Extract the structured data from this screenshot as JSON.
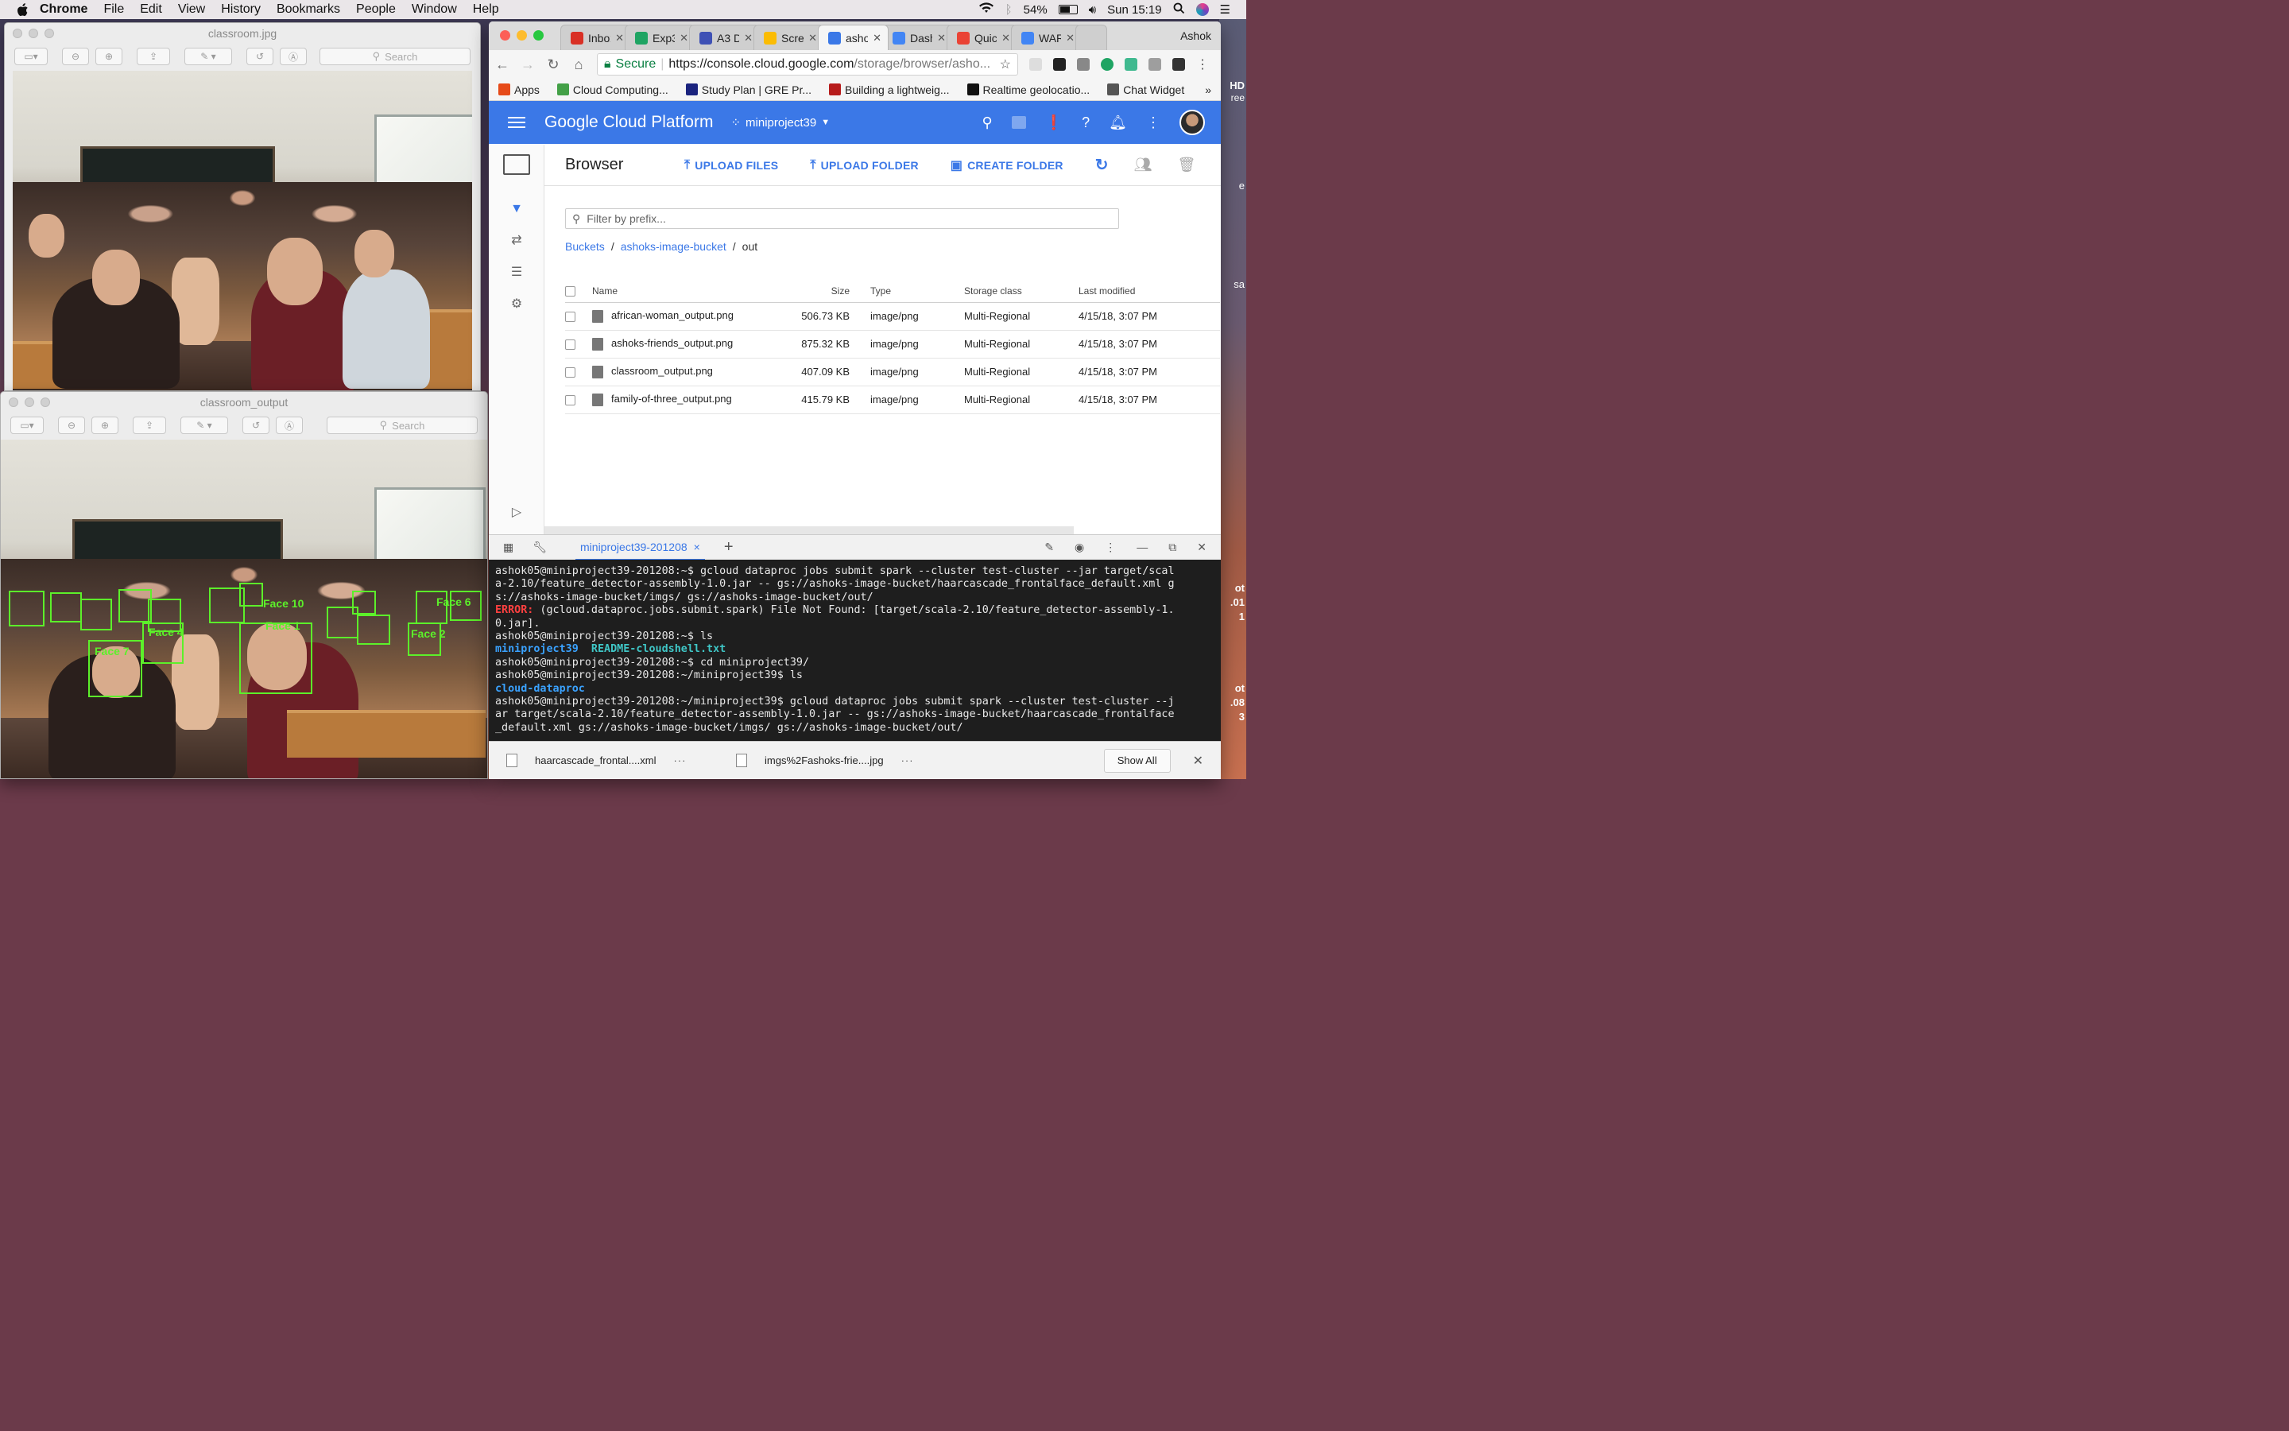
{
  "menubar": {
    "app": "Chrome",
    "items": [
      "File",
      "Edit",
      "View",
      "History",
      "Bookmarks",
      "People",
      "Window",
      "Help"
    ],
    "battery": "54%",
    "clock": "Sun 15:19"
  },
  "desktop": {
    "labels": [
      "HD",
      "ree",
      "e",
      "sa",
      "ot",
      ".01",
      "1",
      "ot",
      ".08",
      "3"
    ]
  },
  "preview_top": {
    "title": "classroom.jpg",
    "search_placeholder": "Search"
  },
  "preview_bottom": {
    "title": "classroom_output",
    "search_placeholder": "Search",
    "face_labels": [
      "Face 10",
      "Face 1",
      "Face 7",
      "Face 4",
      "Face 2",
      "Face 6"
    ]
  },
  "chrome": {
    "tabs": [
      {
        "title": "Inbox",
        "color": "#d93025"
      },
      {
        "title": "Exp3",
        "color": "#1fa463"
      },
      {
        "title": "A3 D(",
        "color": "#3f51b5"
      },
      {
        "title": "Scree",
        "color": "#fbbc04"
      },
      {
        "title": "ashol",
        "color": "#3b78e7"
      },
      {
        "title": "Dashl",
        "color": "#4285f4"
      },
      {
        "title": "Quick",
        "color": "#ea4335"
      },
      {
        "title": "WARI",
        "color": "#4285f4"
      }
    ],
    "profile": "Ashok",
    "secure_label": "Secure",
    "url_host": "https://console.cloud.google.com",
    "url_path": "/storage/browser/asho...",
    "bookmarks": [
      {
        "label": "Apps",
        "color": "#e64a19"
      },
      {
        "label": "Cloud Computing...",
        "color": "#43a047"
      },
      {
        "label": "Study Plan | GRE Pr...",
        "color": "#1a237e"
      },
      {
        "label": "Building a lightweig...",
        "color": "#b71c1c"
      },
      {
        "label": "Realtime geolocatio...",
        "color": "#111111"
      },
      {
        "label": "Chat Widget",
        "color": "#555555"
      }
    ]
  },
  "gcp": {
    "brand": "Google Cloud Platform",
    "project": "miniproject39",
    "page_title": "Browser",
    "actions": {
      "upload_files": "UPLOAD FILES",
      "upload_folder": "UPLOAD FOLDER",
      "create_folder": "CREATE FOLDER"
    },
    "filter_placeholder": "Filter by prefix...",
    "breadcrumb": {
      "root": "Buckets",
      "bucket": "ashoks-image-bucket",
      "folder": "out"
    },
    "columns": {
      "name": "Name",
      "size": "Size",
      "type": "Type",
      "storage": "Storage class",
      "modified": "Last modified"
    },
    "files": [
      {
        "name": "african-woman_output.png",
        "size": "506.73 KB",
        "type": "image/png",
        "storage": "Multi-Regional",
        "modified": "4/15/18, 3:07 PM"
      },
      {
        "name": "ashoks-friends_output.png",
        "size": "875.32 KB",
        "type": "image/png",
        "storage": "Multi-Regional",
        "modified": "4/15/18, 3:07 PM"
      },
      {
        "name": "classroom_output.png",
        "size": "407.09 KB",
        "type": "image/png",
        "storage": "Multi-Regional",
        "modified": "4/15/18, 3:07 PM"
      },
      {
        "name": "family-of-three_output.png",
        "size": "415.79 KB",
        "type": "image/png",
        "storage": "Multi-Regional",
        "modified": "4/15/18, 3:07 PM"
      }
    ]
  },
  "shell": {
    "tab": "miniproject39-201208",
    "lines": [
      {
        "t": "ashok05@miniproject39-201208:~$ gcloud dataproc jobs submit spark --cluster test-cluster --jar target/scal"
      },
      {
        "t": "a-2.10/feature_detector-assembly-1.0.jar -- gs://ashoks-image-bucket/haarcascade_frontalface_default.xml g"
      },
      {
        "t": "s://ashoks-image-bucket/imgs/ gs://ashoks-image-bucket/out/"
      },
      {
        "err": "ERROR:",
        "t": " (gcloud.dataproc.jobs.submit.spark) File Not Found: [target/scala-2.10/feature_detector-assembly-1."
      },
      {
        "t": "0.jar]."
      },
      {
        "t": "ashok05@miniproject39-201208:~$ ls"
      },
      {
        "dir": "miniproject39",
        "file": "  README-cloudshell.txt"
      },
      {
        "t": "ashok05@miniproject39-201208:~$ cd miniproject39/"
      },
      {
        "t": "ashok05@miniproject39-201208:~/miniproject39$ ls"
      },
      {
        "dir": "cloud-dataproc"
      },
      {
        "t": "ashok05@miniproject39-201208:~/miniproject39$ gcloud dataproc jobs submit spark --cluster test-cluster --j"
      },
      {
        "t": "ar target/scala-2.10/feature_detector-assembly-1.0.jar -- gs://ashoks-image-bucket/haarcascade_frontalface"
      },
      {
        "t": "_default.xml gs://ashoks-image-bucket/imgs/ gs://ashoks-image-bucket/out/"
      }
    ]
  },
  "downloads": {
    "items": [
      "haarcascade_frontal....xml",
      "imgs%2Fashoks-frie....jpg"
    ],
    "show_all": "Show All"
  }
}
